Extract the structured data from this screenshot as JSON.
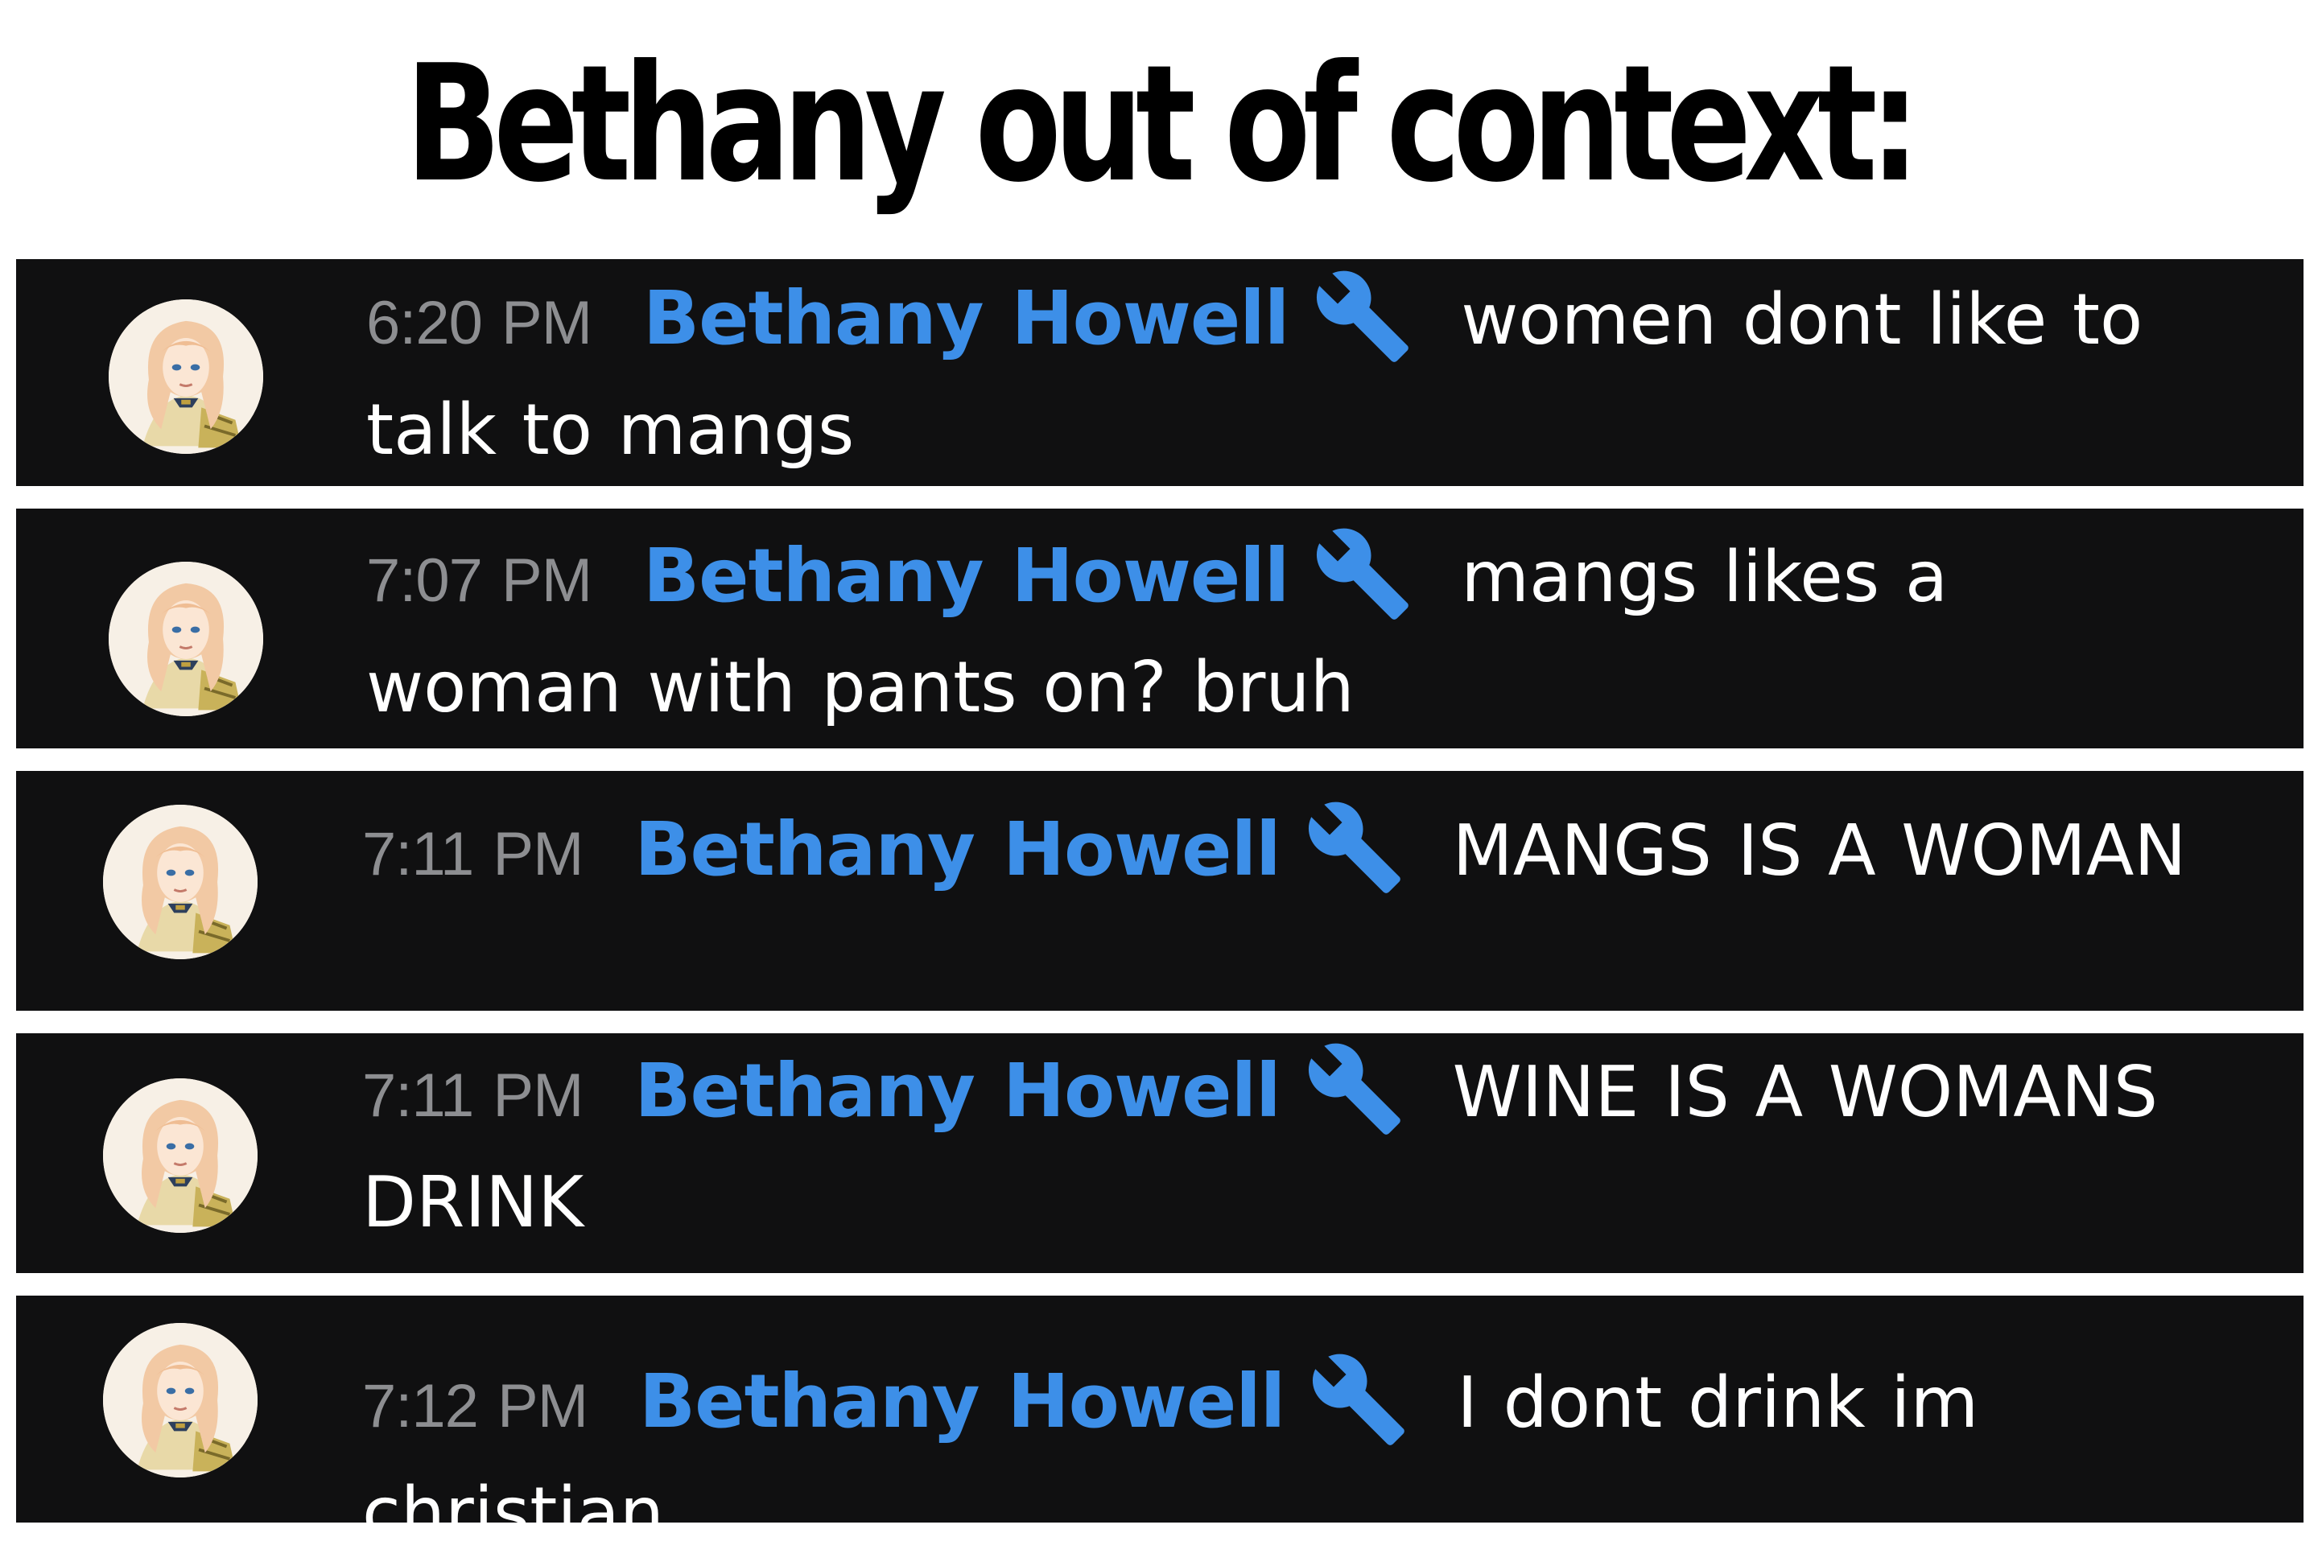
{
  "header": {
    "title": "Bethany out of context:"
  },
  "colors": {
    "panel_background": "#101011",
    "author_name": "#3d8fe8",
    "timestamp": "#8d8e91",
    "role_icon": "#3d8fe8",
    "message_text": "#ffffff"
  },
  "messages": [
    {
      "time": "6:20 PM",
      "author": "Bethany Howell",
      "role_icon": "wrench-icon",
      "text": "women dont like to talk to mangs"
    },
    {
      "time": "7:07 PM",
      "author": "Bethany Howell",
      "role_icon": "wrench-icon",
      "text": "mangs likes a woman with pants on? bruh"
    },
    {
      "time": "7:11 PM",
      "author": "Bethany Howell",
      "role_icon": "wrench-icon",
      "text": "MANGS IS A WOMAN"
    },
    {
      "time": "7:11 PM",
      "author": "Bethany Howell",
      "role_icon": "wrench-icon",
      "text": "WINE IS A WOMANS DRINK"
    },
    {
      "time": "7:12 PM",
      "author": "Bethany Howell",
      "role_icon": "wrench-icon",
      "text": "I dont drink im christian"
    }
  ]
}
